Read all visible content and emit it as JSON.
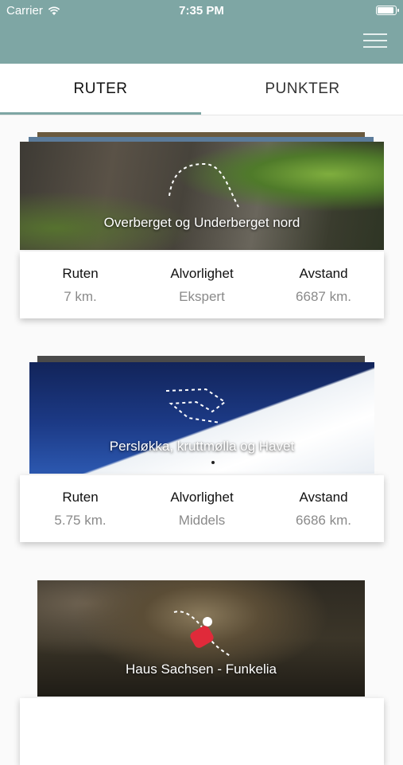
{
  "status_bar": {
    "carrier": "Carrier",
    "time": "7:35 PM",
    "battery_level": 1.0
  },
  "tabs": [
    {
      "label": "RUTER",
      "active": true
    },
    {
      "label": "PUNKTER",
      "active": false
    }
  ],
  "routes": [
    {
      "title": "Overberget og Underberget nord",
      "labels": {
        "route": "Ruten",
        "severity": "Alvorlighet",
        "distance": "Avstand"
      },
      "values": {
        "route": "7 km.",
        "severity": "Ekspert",
        "distance": "6687 km."
      }
    },
    {
      "title": "Persløkka, kruttmølla og Havet",
      "labels": {
        "route": "Ruten",
        "severity": "Alvorlighet",
        "distance": "Avstand"
      },
      "values": {
        "route": "5.75 km.",
        "severity": "Middels",
        "distance": "6686 km."
      }
    },
    {
      "title": "Haus Sachsen - Funkelia"
    }
  ],
  "colors": {
    "nav_background": "#7ea6a4",
    "tab_underline": "#7ea6a4"
  }
}
